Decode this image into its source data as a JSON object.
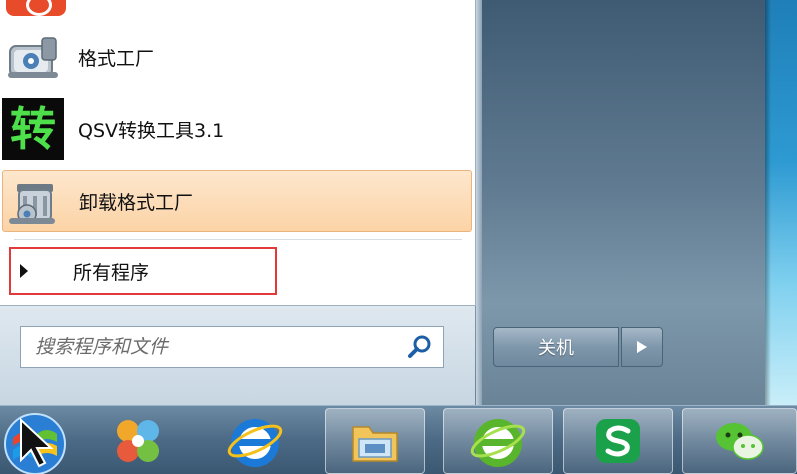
{
  "start_menu": {
    "programs": [
      {
        "label": "格式工厂",
        "icon": "format-factory-icon"
      },
      {
        "label": "QSV转换工具3.1",
        "icon": "qsv-converter-icon"
      },
      {
        "label": "卸载格式工厂",
        "icon": "uninstall-format-factory-icon"
      }
    ],
    "all_programs_label": "所有程序",
    "search_placeholder": "搜索程序和文件",
    "shutdown_label": "关机"
  },
  "taskbar": {
    "items": [
      "start-orb-icon",
      "app-clover-icon",
      "internet-explorer-icon",
      "file-explorer-icon",
      "green-browser-icon",
      "wps-icon",
      "wechat-icon"
    ]
  },
  "colors": {
    "highlight": "#fcd3a6",
    "all_programs_border": "#e23a3a",
    "taskbar": "#4c6a85"
  },
  "icon_glyphs": {
    "qsv": "转"
  }
}
